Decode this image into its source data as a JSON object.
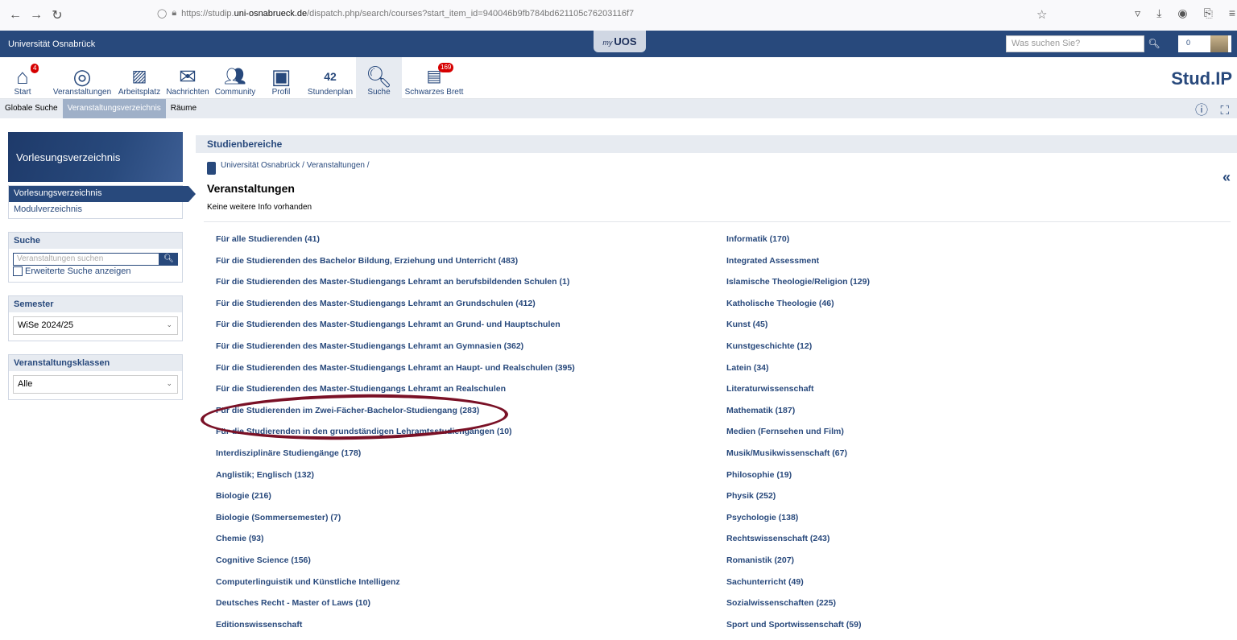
{
  "browser": {
    "url_prefix": "https://studip.",
    "url_domain": "uni-osnabrueck.de",
    "url_rest": "/dispatch.php/search/courses?start_item_id=940046b9fb784bd621105c76203116f7"
  },
  "topbar": {
    "university": "Universität Osnabrück",
    "myuos_prefix": "my",
    "myuos_label": "UOS",
    "search_placeholder": "Was suchen Sie?",
    "count": "0"
  },
  "mainnav": {
    "items": [
      {
        "label": "Start",
        "icon": "home-icon",
        "badge": "4"
      },
      {
        "label": "Veranstaltungen",
        "icon": "seminar-icon"
      },
      {
        "label": "Arbeitsplatz",
        "icon": "workplace-icon"
      },
      {
        "label": "Nachrichten",
        "icon": "mail-icon"
      },
      {
        "label": "Community",
        "icon": "community-icon"
      },
      {
        "label": "Profil",
        "icon": "profile-icon"
      },
      {
        "label": "Stundenplan",
        "icon": "schedule-icon",
        "day": "42"
      },
      {
        "label": "Suche",
        "icon": "search-icon"
      },
      {
        "label": "Schwarzes Brett",
        "icon": "board-icon",
        "badge": "169"
      }
    ],
    "logo": "Stud.IP"
  },
  "subnav": {
    "tabs": [
      "Globale Suche",
      "Veranstaltungsverzeichnis",
      "Räume"
    ]
  },
  "sidebar": {
    "title": "Vorlesungsverzeichnis",
    "links": [
      "Vorlesungsverzeichnis",
      "Modulverzeichnis"
    ],
    "search_title": "Suche",
    "search_placeholder": "Veranstaltungen suchen",
    "advanced_label": "Erweiterte Suche anzeigen",
    "semester_title": "Semester",
    "semester_value": "WiSe 2024/25",
    "classes_title": "Veranstaltungsklassen",
    "classes_value": "Alle"
  },
  "content": {
    "header": "Studienbereiche",
    "breadcrumb": "Universität Osnabrück / Veranstaltungen /",
    "title": "Veranstaltungen",
    "subtitle": "Keine weitere Info vorhanden",
    "left_column": [
      "Für alle Studierenden (41)",
      "Für die Studierenden des Bachelor Bildung, Erziehung und Unterricht (483)",
      "Für die Studierenden des Master-Studiengangs Lehramt an berufsbildenden Schulen (1)",
      "Für die Studierenden des Master-Studiengangs Lehramt an Grundschulen (412)",
      "Für die Studierenden des Master-Studiengangs Lehramt an Grund- und Hauptschulen",
      "Für die Studierenden des Master-Studiengangs Lehramt an Gymnasien (362)",
      "Für die Studierenden des Master-Studiengangs Lehramt an Haupt- und Realschulen (395)",
      "Für die Studierenden des Master-Studiengangs Lehramt an Realschulen",
      "Für die Studierenden im Zwei-Fächer-Bachelor-Studiengang (283)",
      "Für die Studierenden in den grundständigen Lehramtsstudiengängen (10)",
      "Interdisziplinäre Studiengänge (178)",
      "Anglistik; Englisch (132)",
      "Biologie (216)",
      "Biologie (Sommersemester) (7)",
      "Chemie (93)",
      "Cognitive Science (156)",
      "Computerlinguistik und Künstliche Intelligenz",
      "Deutsches Recht - Master of Laws (10)",
      "Editionswissenschaft"
    ],
    "right_column": [
      "Informatik (170)",
      "Integrated Assessment",
      "Islamische Theologie/Religion (129)",
      "Katholische Theologie (46)",
      "Kunst (45)",
      "Kunstgeschichte (12)",
      "Latein (34)",
      "Literaturwissenschaft",
      "Mathematik (187)",
      "Medien (Fernsehen und Film)",
      "Musik/Musikwissenschaft (67)",
      "Philosophie (19)",
      "Physik (252)",
      "Psychologie (138)",
      "Rechtswissenschaft (243)",
      "Romanistik (207)",
      "Sachunterricht (49)",
      "Sozialwissenschaften (225)",
      "Sport und Sportwissenschaft (59)"
    ]
  },
  "highlight_color": "#7a1126"
}
